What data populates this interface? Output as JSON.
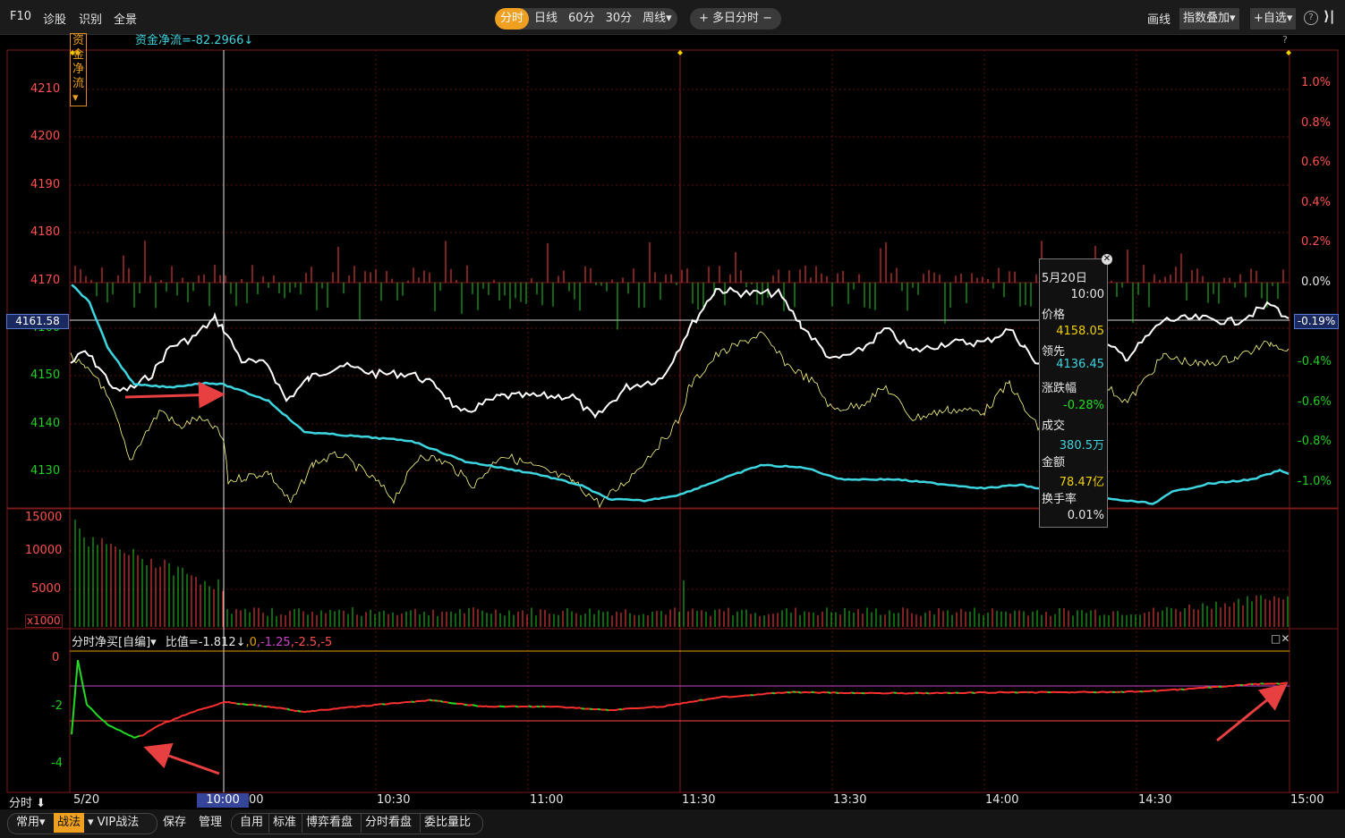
{
  "topbar": {
    "left_items": [
      "F10",
      "诊股",
      "识别",
      "全景"
    ],
    "tabs": [
      "分时",
      "日线",
      "60分",
      "30分",
      "周线▾"
    ],
    "active_tab": "分时",
    "multi_day": "+ 多日分时 −",
    "draw_line": "画线",
    "index_overlay": "指数叠加▾",
    "watchlist": "+自选▾",
    "help": "?",
    "collapse": "⟩|"
  },
  "legend": {
    "indicator": "资金净流▾",
    "value": "资金净流=-82.2966↓",
    "help": "?"
  },
  "price_axis": {
    "ticks": [
      "4210",
      "4200",
      "4190",
      "4180",
      "4170",
      "4160",
      "4150",
      "4140",
      "4130"
    ],
    "current": "4161.58",
    "pct_ticks": [
      "1.0%",
      "0.8%",
      "0.6%",
      "0.4%",
      "0.2%",
      "0.0%",
      "-0.19%",
      "-0.4%",
      "-0.6%",
      "-0.8%",
      "-1.0%"
    ]
  },
  "volume_axis": {
    "ticks": [
      "15000",
      "10000",
      "5000",
      "x1000"
    ]
  },
  "tooltip": {
    "date": "5月20日",
    "time": "10:00",
    "rows": [
      {
        "label": "价格",
        "value": "4158.05",
        "color": "#f0d000"
      },
      {
        "label": "领先",
        "value": "4136.45",
        "color": "#3dd6e0"
      },
      {
        "label": "涨跌幅",
        "value": "-0.28%",
        "color": "#22dd22"
      },
      {
        "label": "成交",
        "value": "380.5万",
        "color": "#3dd6e0"
      },
      {
        "label": "金额",
        "value": "78.47亿",
        "color": "#f0d000"
      },
      {
        "label": "换手率",
        "value": "0.01%",
        "color": "#e6e6e6"
      }
    ]
  },
  "indicator2": {
    "name": "分时净买[自编]▾",
    "ratio": "比值=-1.812↓",
    "p0": ",0",
    "p1": ",-1.25",
    "p2": ",-2.5",
    "p3": ",-5",
    "ticks": [
      "0",
      "-2",
      "-4"
    ],
    "window_icons": "□✕"
  },
  "time_axis": {
    "mode": "分时 ⬇",
    "date": "5/20",
    "crosshair": "10:00",
    "cut": "00",
    "labels": [
      "10:30",
      "11:00",
      "11:30",
      "13:30",
      "14:00",
      "14:30",
      "15:00"
    ]
  },
  "bottombar": {
    "common": "常用▾",
    "tactics": "战法",
    "vip": "▾ VIP战法",
    "save": "保存",
    "manage": "管理",
    "tabs": [
      "自用",
      "标准",
      "博弈看盘",
      "分时看盘",
      "委比量比"
    ]
  },
  "colors": {
    "price_line": "#ffffff",
    "lead_line": "#ffff88",
    "avg_line": "#3dd6e0",
    "up": "#ff4444",
    "down": "#22cc22",
    "grid": "#6a1010",
    "arrow": "#e84040",
    "highlight": "#f0a020"
  }
}
